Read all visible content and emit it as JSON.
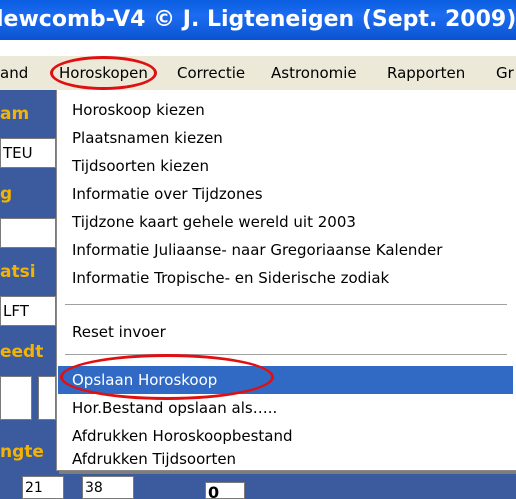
{
  "window": {
    "title": "lewcomb-V4 © J. Ligteneigen (Sept. 2009)"
  },
  "menubar": {
    "items": [
      "and",
      "Horoskopen",
      "Correctie",
      "Astronomie",
      "Rapporten",
      "Gr"
    ],
    "active": "Horoskopen"
  },
  "left_panel": {
    "labels": [
      "am",
      "g",
      "atsi",
      "eedt",
      "ngte"
    ],
    "fields": [
      "TEU",
      "",
      "LFT",
      "",
      "",
      "21",
      "38",
      "0"
    ]
  },
  "dropdown": {
    "items": [
      {
        "label": "Horoskoop kiezen"
      },
      {
        "label": "Plaatsnamen kiezen"
      },
      {
        "label": "Tijdsoorten kiezen"
      },
      {
        "label": "Informatie over Tijdzones"
      },
      {
        "label": "Tijdzone kaart gehele wereld uit 2003"
      },
      {
        "label": "Informatie Juliaanse- naar Gregoriaanse Kalender"
      },
      {
        "label": "Informatie Tropische- en Siderische zodiak"
      },
      {
        "label": "Reset invoer"
      },
      {
        "label": "Opslaan Horoskoop",
        "highlighted": true
      },
      {
        "label": "Hor.Bestand opslaan als….."
      },
      {
        "label": "Afdrukken Horoskoopbestand"
      },
      {
        "label": "Afdrukken Tijdsoorten"
      }
    ]
  },
  "colors": {
    "titlebar": "#0a5ee0",
    "highlight": "#316ac5",
    "panel": "#3b5b9e",
    "label": "#f3b300",
    "annotation": "#e01010"
  }
}
